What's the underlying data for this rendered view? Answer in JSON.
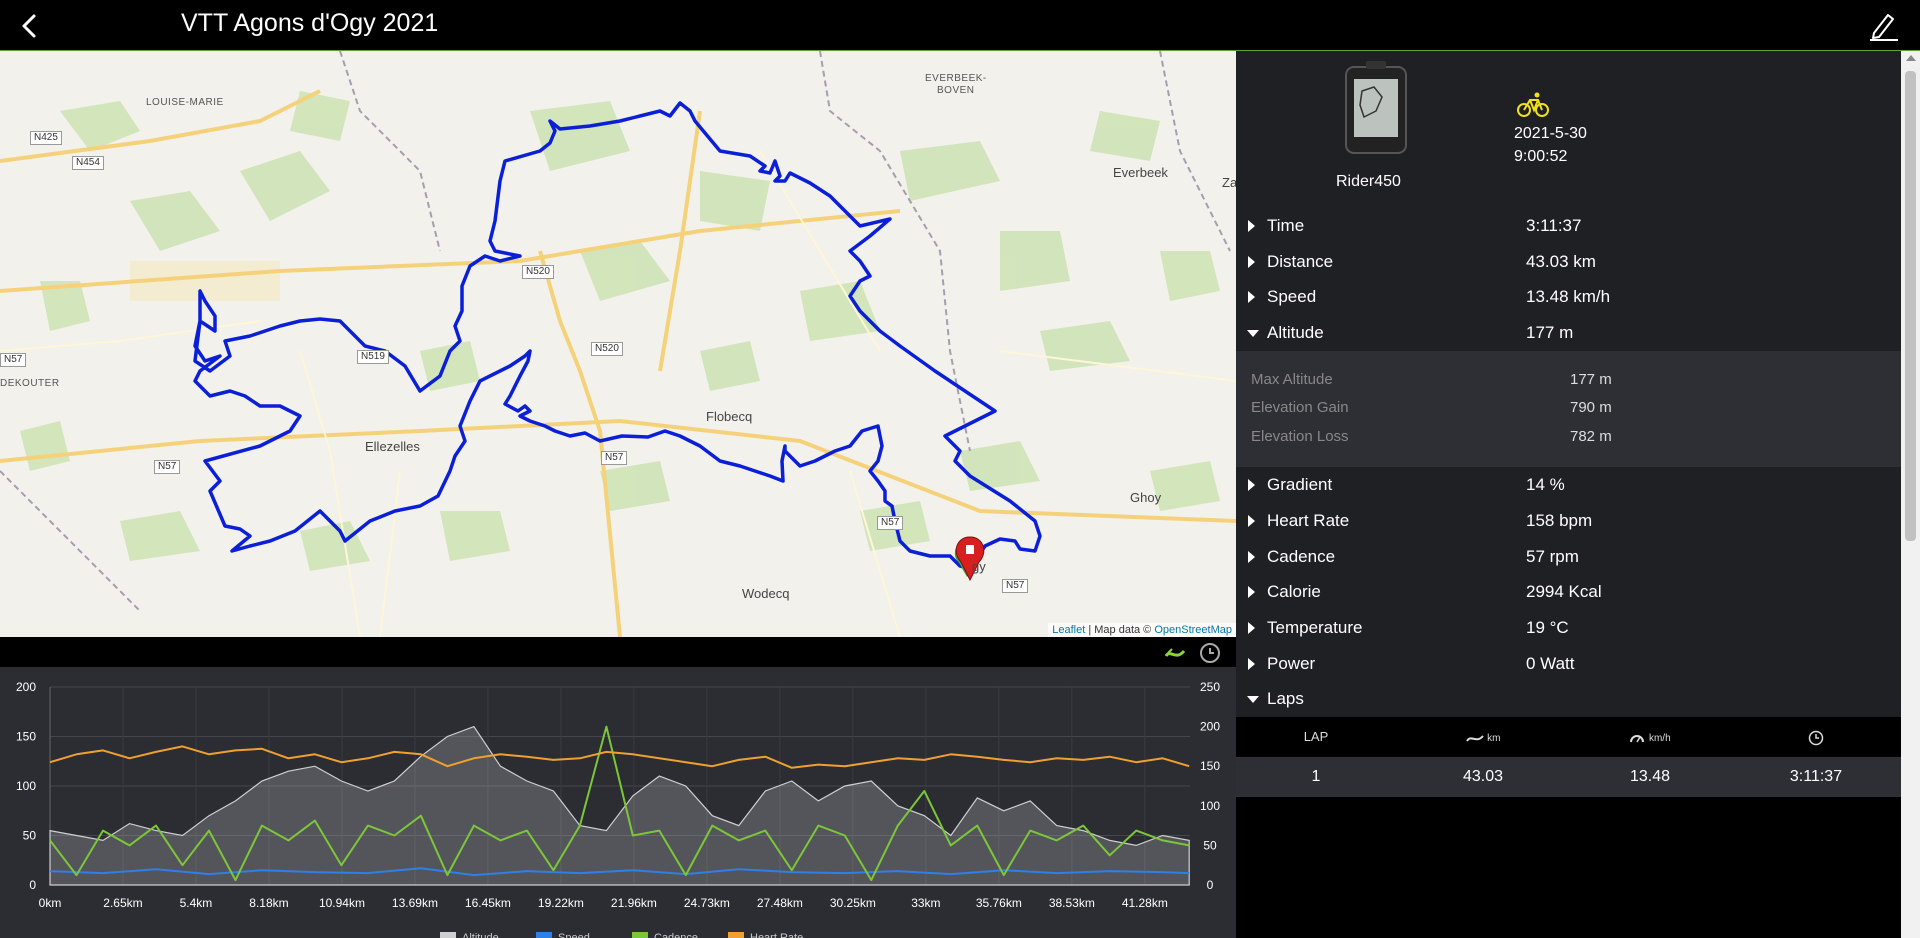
{
  "header": {
    "title": "VTT Agons d'Ogy 2021"
  },
  "map": {
    "places": [
      {
        "name": "LOUISE-MARIE",
        "small": true
      },
      {
        "name": "EVERBEEK-",
        "small": true
      },
      {
        "name": "BOVEN",
        "small": true
      },
      {
        "name": "Everbeek",
        "small": false
      },
      {
        "name": "Za",
        "small": false
      },
      {
        "name": "DEKOUTER",
        "small": true
      },
      {
        "name": "Ellezelles",
        "small": false
      },
      {
        "name": "Flobecq",
        "small": false
      },
      {
        "name": "Ghoy",
        "small": false
      },
      {
        "name": "Wodecq",
        "small": false
      },
      {
        "name": "gy",
        "small": false
      }
    ],
    "roads": [
      "N425",
      "N454",
      "N520",
      "N520",
      "N57",
      "N57",
      "N57",
      "N57",
      "N519",
      "N57"
    ],
    "attribution": {
      "leaflet": "Leaflet",
      "separator": " | Map data © ",
      "osm": "OpenStreetMap"
    },
    "route_color": "#0a1fd6"
  },
  "chart_data": {
    "type": "line",
    "x_ticks": [
      "0km",
      "2.65km",
      "5.4km",
      "8.18km",
      "10.94km",
      "13.69km",
      "16.45km",
      "19.22km",
      "21.96km",
      "24.73km",
      "27.48km",
      "30.25km",
      "33km",
      "35.76km",
      "38.53km",
      "41.28km"
    ],
    "y_left": {
      "ticks": [
        0,
        50,
        100,
        150,
        200
      ],
      "lim": [
        0,
        200
      ]
    },
    "y_right": {
      "ticks": [
        0,
        50,
        100,
        150,
        200,
        250
      ],
      "lim": [
        0,
        250
      ]
    },
    "xlim": [
      0,
      43.03
    ],
    "series": [
      {
        "name": "Altitude",
        "color": "#cfcfcf",
        "axis": "left",
        "type": "area",
        "x": [
          0,
          1,
          2,
          3,
          4,
          5,
          6,
          7,
          8,
          9,
          10,
          11,
          12,
          13,
          14,
          15,
          16,
          17,
          18,
          19,
          20,
          21,
          22,
          23,
          24,
          25,
          26,
          27,
          28,
          29,
          30,
          31,
          32,
          33,
          34,
          35,
          36,
          37,
          38,
          39,
          40,
          41,
          42,
          43
        ],
        "values": [
          55,
          50,
          45,
          62,
          55,
          50,
          70,
          85,
          105,
          115,
          120,
          105,
          95,
          105,
          130,
          150,
          160,
          120,
          105,
          95,
          60,
          55,
          90,
          110,
          100,
          70,
          60,
          95,
          105,
          85,
          100,
          105,
          80,
          70,
          50,
          88,
          75,
          85,
          60,
          55,
          45,
          40,
          50,
          45
        ]
      },
      {
        "name": "Speed",
        "color": "#2f7fe8",
        "axis": "left",
        "type": "line",
        "x": [
          0,
          2,
          4,
          6,
          8,
          10,
          12,
          14,
          16,
          18,
          20,
          22,
          24,
          26,
          28,
          30,
          32,
          34,
          36,
          38,
          40,
          42,
          43
        ],
        "values": [
          14,
          12,
          16,
          11,
          15,
          13,
          12,
          17,
          10,
          14,
          12,
          15,
          11,
          16,
          13,
          12,
          14,
          11,
          15,
          12,
          14,
          13,
          12
        ]
      },
      {
        "name": "Cadence",
        "color": "#7cc63a",
        "axis": "left",
        "type": "line",
        "x": [
          0,
          1,
          2,
          3,
          4,
          5,
          6,
          7,
          8,
          9,
          10,
          11,
          12,
          13,
          14,
          15,
          16,
          17,
          18,
          19,
          20,
          21,
          22,
          23,
          24,
          25,
          26,
          27,
          28,
          29,
          30,
          31,
          32,
          33,
          34,
          35,
          36,
          37,
          38,
          39,
          40,
          41,
          42,
          43
        ],
        "values": [
          45,
          10,
          55,
          40,
          60,
          20,
          55,
          5,
          60,
          45,
          65,
          20,
          60,
          50,
          70,
          10,
          60,
          45,
          55,
          15,
          60,
          160,
          50,
          55,
          10,
          60,
          45,
          55,
          15,
          60,
          50,
          5,
          60,
          95,
          40,
          60,
          10,
          55,
          45,
          60,
          30,
          55,
          45,
          40
        ]
      },
      {
        "name": "Heart Rate",
        "color": "#f0a030",
        "axis": "right",
        "type": "line",
        "x": [
          0,
          1,
          2,
          3,
          4,
          5,
          6,
          7,
          8,
          9,
          10,
          11,
          12,
          13,
          14,
          15,
          16,
          17,
          18,
          19,
          20,
          21,
          22,
          23,
          24,
          25,
          26,
          27,
          28,
          29,
          30,
          31,
          32,
          33,
          34,
          35,
          36,
          37,
          38,
          39,
          40,
          41,
          42,
          43
        ],
        "values": [
          155,
          165,
          170,
          160,
          168,
          175,
          165,
          170,
          172,
          160,
          165,
          155,
          160,
          168,
          165,
          150,
          160,
          165,
          162,
          158,
          160,
          168,
          165,
          160,
          155,
          150,
          158,
          162,
          148,
          152,
          150,
          155,
          160,
          158,
          165,
          162,
          158,
          155,
          160,
          158,
          162,
          155,
          160,
          150
        ]
      }
    ]
  },
  "device": {
    "name": "Rider450",
    "date": "2021-5-30",
    "time": "9:00:52"
  },
  "stats": [
    {
      "label": "Time",
      "value": "3:11:37",
      "open": false
    },
    {
      "label": "Distance",
      "value": "43.03 km",
      "open": false
    },
    {
      "label": "Speed",
      "value": "13.48 km/h",
      "open": false
    },
    {
      "label": "Altitude",
      "value": "177 m",
      "open": true
    },
    {
      "label": "Gradient",
      "value": "14 %",
      "open": false
    },
    {
      "label": "Heart Rate",
      "value": "158 bpm",
      "open": false
    },
    {
      "label": "Cadence",
      "value": "57 rpm",
      "open": false
    },
    {
      "label": "Calorie",
      "value": "2994 Kcal",
      "open": false
    },
    {
      "label": "Temperature",
      "value": "19 °C",
      "open": false
    },
    {
      "label": "Power",
      "value": "0 Watt",
      "open": false
    },
    {
      "label": "Laps",
      "value": "",
      "open": true
    }
  ],
  "altitude_detail": [
    {
      "label": "Max Altitude",
      "value": "177 m"
    },
    {
      "label": "Elevation Gain",
      "value": "790 m"
    },
    {
      "label": "Elevation Loss",
      "value": "782 m"
    }
  ],
  "laps": {
    "headers": {
      "lap": "LAP",
      "dist_unit": "km",
      "speed_unit": "km/h"
    },
    "rows": [
      {
        "lap": "1",
        "distance": "43.03",
        "speed": "13.48",
        "time": "3:11:37"
      }
    ]
  }
}
